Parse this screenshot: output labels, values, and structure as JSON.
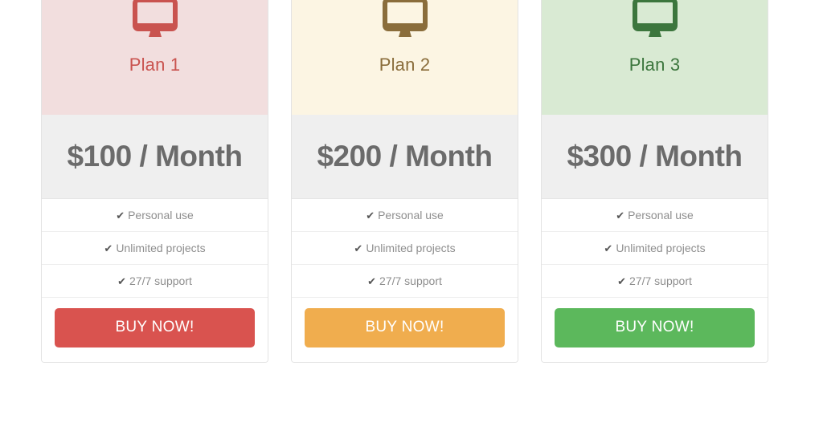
{
  "page": {
    "background": "#ffffff",
    "layout": "three-column-pricing-table"
  },
  "common": {
    "icon_name": "desktop-monitor-icon",
    "check_icon_name": "check-icon",
    "check_glyph": "✔",
    "price_color": "#6b6b6b",
    "price_row_background": "#efefef",
    "feature_text_color": "#8e8e8e",
    "card_border_color": "#e3e3e3",
    "divider_color": "#eeeeee"
  },
  "plans": [
    {
      "id": "plan-1",
      "title": "Plan 1",
      "price": "$100 / Month",
      "header_background": "#f2dede",
      "accent_color": "#c9534f",
      "title_color": "#c9534f",
      "button_label": "BUY NOW!",
      "button_color": "#d9534f",
      "features": [
        "Personal use",
        "Unlimited projects",
        "27/7 support"
      ]
    },
    {
      "id": "plan-2",
      "title": "Plan 2",
      "price": "$200 / Month",
      "header_background": "#fcf5e3",
      "accent_color": "#8a6d3b",
      "title_color": "#8a6d3b",
      "button_label": "BUY NOW!",
      "button_color": "#f0ad4e",
      "features": [
        "Personal use",
        "Unlimited projects",
        "27/7 support"
      ]
    },
    {
      "id": "plan-3",
      "title": "Plan 3",
      "price": "$300 / Month",
      "header_background": "#d9ead3",
      "accent_color": "#3c763d",
      "title_color": "#3c763d",
      "button_label": "BUY NOW!",
      "button_color": "#5cb85c",
      "features": [
        "Personal use",
        "Unlimited projects",
        "27/7 support"
      ]
    }
  ]
}
